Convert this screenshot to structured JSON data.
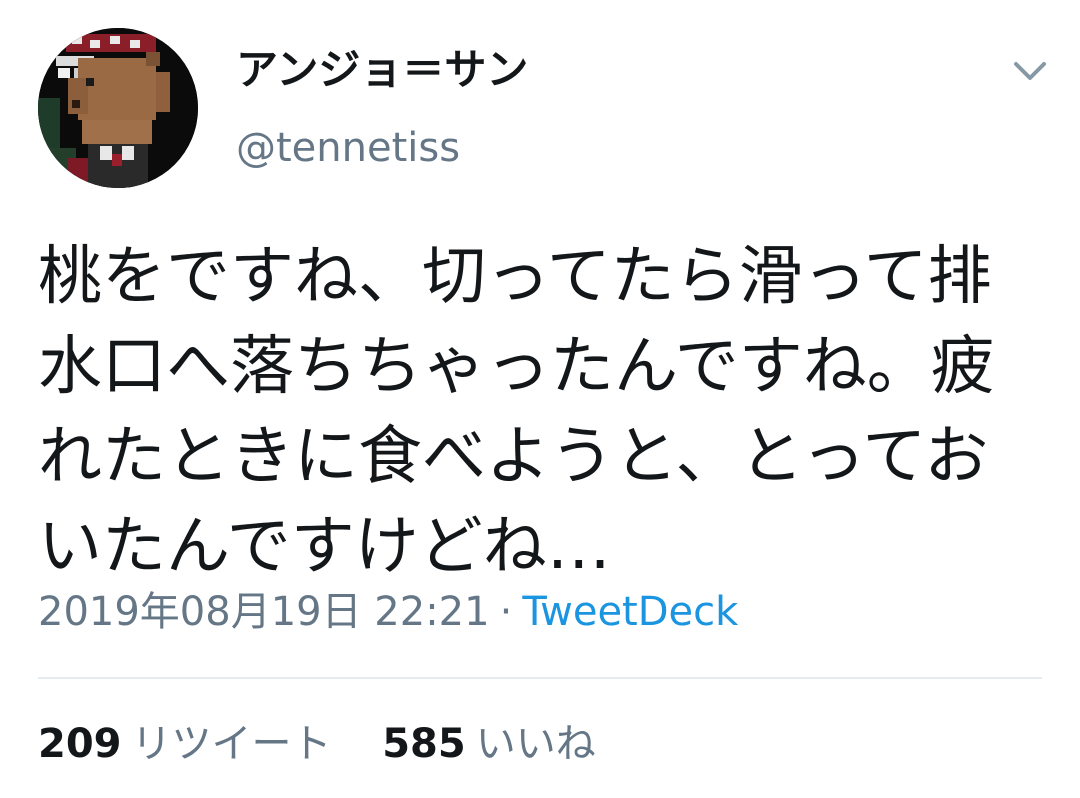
{
  "user": {
    "display_name": "アンジョ＝サン",
    "handle": "@tennetiss",
    "avatar_icon": "pixel-art-capybara-avatar-icon"
  },
  "menu": {
    "caret_icon": "chevron-down-icon"
  },
  "tweet": {
    "text": "桃をですね、切ってたら滑って排水口へ落ちちゃったんですね。疲れたときに食べようと、とっておいたんですけどね…",
    "timestamp": "2019年08月19日 22:21",
    "separator": "·",
    "source": "TweetDeck"
  },
  "stats": {
    "retweets_count": "209",
    "retweets_label": "リツイート",
    "likes_count": "585",
    "likes_label": "いいね"
  },
  "colors": {
    "text": "#14171a",
    "secondary": "#657786",
    "link": "#1b95e0",
    "divider": "#e6ecf0"
  }
}
